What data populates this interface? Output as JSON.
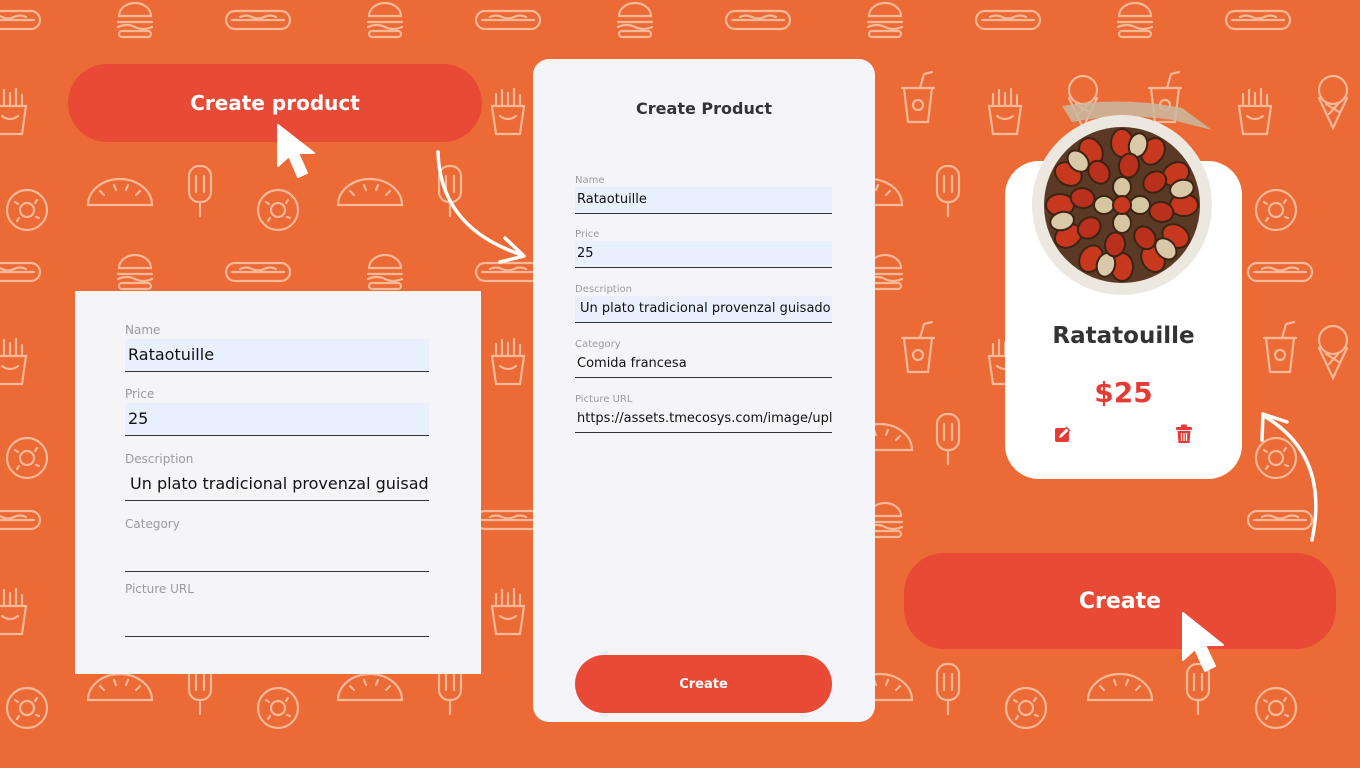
{
  "buttons": {
    "create_product": "Create product",
    "create": "Create"
  },
  "left_form": {
    "name_label": "Name",
    "name_value": "Rataotuille",
    "price_label": "Price",
    "price_value": "25",
    "description_label": "Description",
    "description_value": "Un plato tradicional provenzal guisado",
    "category_label": "Category",
    "category_value": "",
    "picture_label": "Picture URL",
    "picture_value": ""
  },
  "mobile_form": {
    "title": "Create Product",
    "name_label": "Name",
    "name_value": "Rataotuille",
    "price_label": "Price",
    "price_value": "25",
    "description_label": "Description",
    "description_value": "Un plato tradicional provenzal guisado v",
    "category_label": "Category",
    "category_value": "Comida francesa",
    "picture_label": "Picture URL",
    "picture_value": "https://assets.tmecosys.com/image/uplo",
    "submit_label": "Create"
  },
  "product_card": {
    "name": "Ratatouille",
    "price": "$25",
    "edit_icon": "edit-icon",
    "delete_icon": "trash-icon"
  },
  "colors": {
    "background": "#ec6a35",
    "accent": "#e84a36",
    "price": "#e53b35"
  }
}
